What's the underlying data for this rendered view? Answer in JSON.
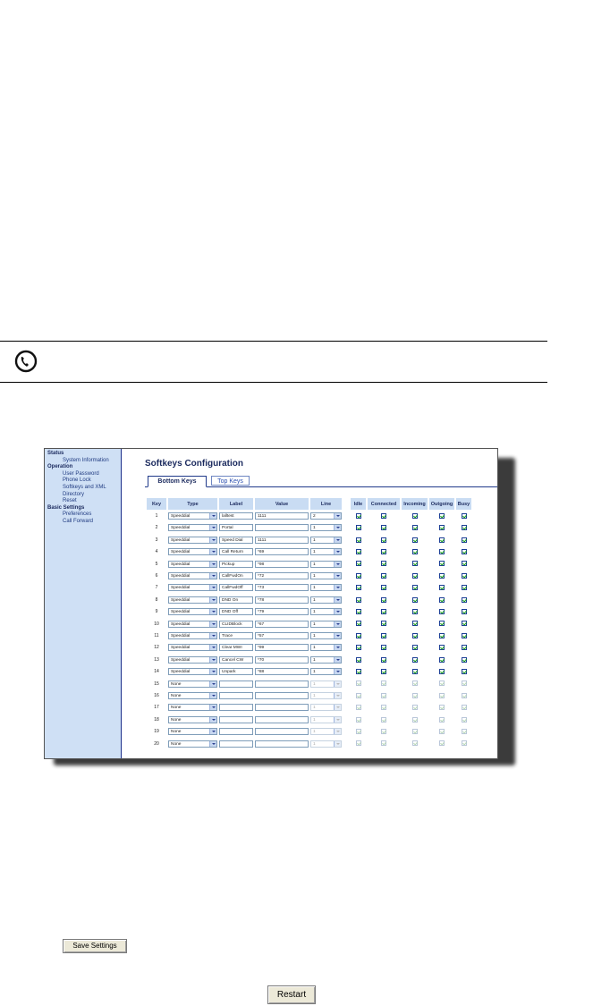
{
  "sidebar": {
    "sections": [
      {
        "heading": "Status",
        "items": [
          "System Information"
        ]
      },
      {
        "heading": "Operation",
        "items": [
          "User Password",
          "Phone Lock",
          "Softkeys and XML",
          "Directory",
          "Reset"
        ]
      },
      {
        "heading": "Basic Settings",
        "items": [
          "Preferences",
          "Call Forward"
        ]
      }
    ]
  },
  "page": {
    "title": "Softkeys Configuration",
    "tabs": [
      {
        "label": "Bottom Keys",
        "active": true
      },
      {
        "label": "Top Keys",
        "active": false
      }
    ]
  },
  "table": {
    "headers": {
      "key": "Key",
      "type": "Type",
      "label": "Label",
      "value": "Value",
      "line": "Line",
      "idle": "Idle",
      "connected": "Connected",
      "incoming": "Incoming",
      "outgoing": "Outgoing",
      "busy": "Busy"
    },
    "rows": [
      {
        "key": "1",
        "type": "Speeddial",
        "label": "lalltest",
        "value": "1111",
        "line": "2",
        "enabled": true
      },
      {
        "key": "2",
        "type": "Speeddial",
        "label": "Portal",
        "value": "",
        "line": "1",
        "enabled": true
      },
      {
        "key": "3",
        "type": "Speeddial",
        "label": "Speed Dial",
        "value": "1111",
        "line": "1",
        "enabled": true
      },
      {
        "key": "4",
        "type": "Speeddial",
        "label": "Call Return",
        "value": "*69",
        "line": "1",
        "enabled": true
      },
      {
        "key": "5",
        "type": "Speeddial",
        "label": "Pickup",
        "value": "*98",
        "line": "1",
        "enabled": true
      },
      {
        "key": "6",
        "type": "Speeddial",
        "label": "CallFwdOn",
        "value": "*72",
        "line": "1",
        "enabled": true
      },
      {
        "key": "7",
        "type": "Speeddial",
        "label": "CallFwdOff",
        "value": "*73",
        "line": "1",
        "enabled": true
      },
      {
        "key": "8",
        "type": "Speeddial",
        "label": "DND On",
        "value": "*78",
        "line": "1",
        "enabled": true
      },
      {
        "key": "9",
        "type": "Speeddial",
        "label": "DND Off",
        "value": "*79",
        "line": "1",
        "enabled": true
      },
      {
        "key": "10",
        "type": "Speeddial",
        "label": "CLIDBlock",
        "value": "*67",
        "line": "1",
        "enabled": true
      },
      {
        "key": "11",
        "type": "Speeddial",
        "label": "Trace",
        "value": "*57",
        "line": "1",
        "enabled": true
      },
      {
        "key": "12",
        "type": "Speeddial",
        "label": "Clear MWI",
        "value": "*99",
        "line": "1",
        "enabled": true
      },
      {
        "key": "13",
        "type": "Speeddial",
        "label": "Cancel CW",
        "value": "*70",
        "line": "1",
        "enabled": true
      },
      {
        "key": "14",
        "type": "Speeddial",
        "label": "Unpark",
        "value": "*88",
        "line": "1",
        "enabled": true
      },
      {
        "key": "15",
        "type": "None",
        "label": "",
        "value": "",
        "line": "1",
        "enabled": false
      },
      {
        "key": "16",
        "type": "None",
        "label": "",
        "value": "",
        "line": "1",
        "enabled": false
      },
      {
        "key": "17",
        "type": "None",
        "label": "",
        "value": "",
        "line": "1",
        "enabled": false
      },
      {
        "key": "18",
        "type": "None",
        "label": "",
        "value": "",
        "line": "1",
        "enabled": false
      },
      {
        "key": "19",
        "type": "None",
        "label": "",
        "value": "",
        "line": "1",
        "enabled": false
      },
      {
        "key": "20",
        "type": "None",
        "label": "",
        "value": "",
        "line": "1",
        "enabled": false
      }
    ]
  },
  "buttons": {
    "save": "Save Settings",
    "restart": "Restart"
  },
  "icons": {
    "note": "phone-handset-icon"
  },
  "colors": {
    "sidebar_bg": "#cfe0f5",
    "header_bg": "#c9dcf3",
    "title": "#1b2a5e",
    "check": "#18a018"
  }
}
